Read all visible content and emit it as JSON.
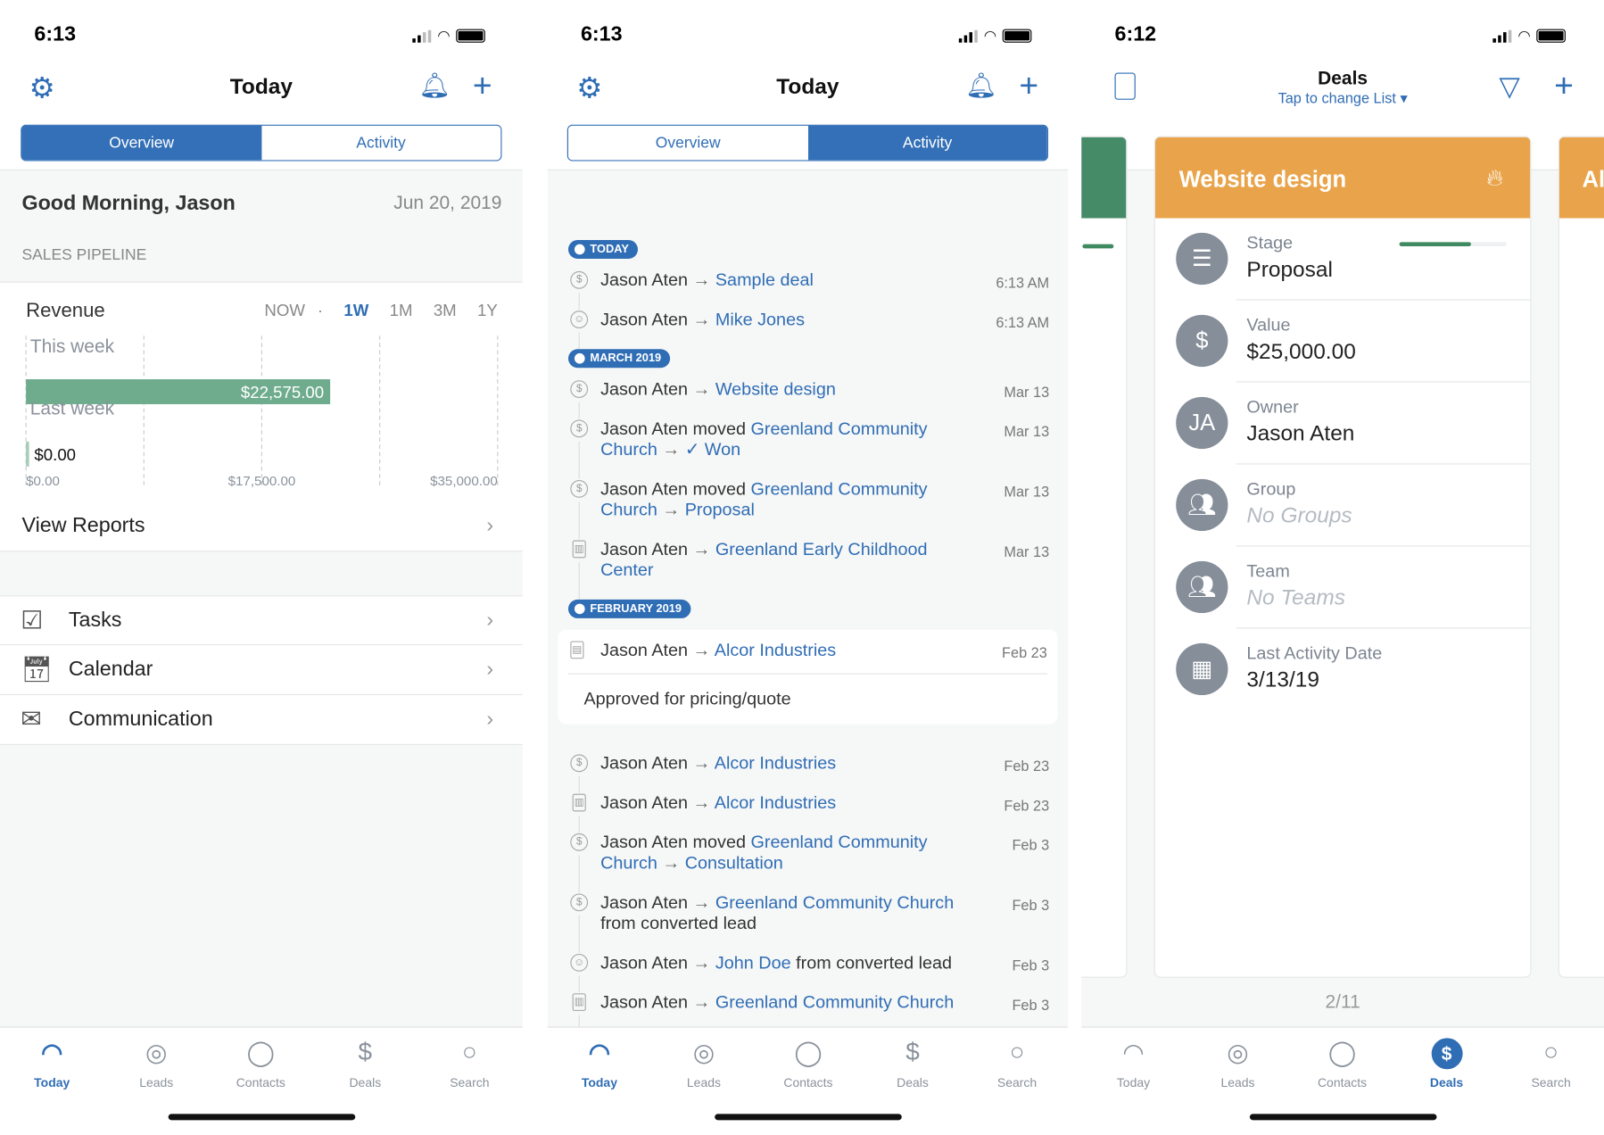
{
  "colors": {
    "accent": "#2f6db5",
    "revenue_bar": "#6fac8e",
    "deal_header": "#e9a44b",
    "prev_deal_header": "#468b68",
    "icon_circle": "#858e99"
  },
  "panels": [
    {
      "status_time": "6:13",
      "title": "Today",
      "segments": [
        "Overview",
        "Activity"
      ],
      "active_segment": 0
    },
    {
      "status_time": "6:13",
      "title": "Today",
      "segments": [
        "Overview",
        "Activity"
      ],
      "active_segment": 1
    },
    {
      "status_time": "6:12",
      "title": "Deals",
      "subtitle": "Tap to change List"
    }
  ],
  "overview": {
    "greeting": "Good Morning, Jason",
    "date": "Jun 20, 2019",
    "section": "SALES PIPELINE",
    "revenue_label": "Revenue",
    "ranges": [
      "NOW",
      "·",
      "1W",
      "1M",
      "3M",
      "1Y"
    ],
    "active_range": "1W",
    "view_reports": "View Reports",
    "menu": [
      {
        "label": "Tasks",
        "icon": "checkbox-icon"
      },
      {
        "label": "Calendar",
        "icon": "calendar-icon"
      },
      {
        "label": "Communication",
        "icon": "communication-icon"
      }
    ]
  },
  "chart_data": {
    "type": "bar",
    "orientation": "horizontal",
    "categories": [
      "This week",
      "Last week"
    ],
    "values": [
      22575,
      0
    ],
    "data_labels": [
      "$22,575.00",
      "$0.00"
    ],
    "xlim": [
      0,
      35000
    ],
    "xticks": [
      "$0.00",
      "$17,500.00",
      "$35,000.00"
    ],
    "grid": true
  },
  "activity": [
    {
      "pill": "TODAY"
    },
    {
      "icon": "deal",
      "parts": [
        [
          "t",
          "Jason Aten "
        ],
        [
          "a",
          "→ "
        ],
        [
          "l",
          "Sample deal"
        ]
      ],
      "time": "6:13 AM"
    },
    {
      "icon": "contact",
      "parts": [
        [
          "t",
          "Jason Aten "
        ],
        [
          "a",
          "→ "
        ],
        [
          "l",
          "Mike Jones"
        ]
      ],
      "time": "6:13 AM"
    },
    {
      "pill": "MARCH 2019"
    },
    {
      "icon": "deal",
      "parts": [
        [
          "t",
          "Jason Aten "
        ],
        [
          "a",
          "→ "
        ],
        [
          "l",
          "Website design"
        ]
      ],
      "time": "Mar 13"
    },
    {
      "icon": "deal",
      "parts": [
        [
          "t",
          "Jason Aten moved "
        ],
        [
          "l",
          "Greenland Community Church"
        ],
        [
          "a",
          " → "
        ],
        [
          "c",
          "✓ Won"
        ]
      ],
      "time": "Mar 13"
    },
    {
      "icon": "deal",
      "parts": [
        [
          "t",
          "Jason Aten moved "
        ],
        [
          "l",
          "Greenland Community Church"
        ],
        [
          "a",
          " → "
        ],
        [
          "l",
          "Proposal"
        ]
      ],
      "time": "Mar 13"
    },
    {
      "icon": "org",
      "parts": [
        [
          "t",
          "Jason Aten "
        ],
        [
          "a",
          "→ "
        ],
        [
          "l",
          "Greenland Early Childhood Center"
        ]
      ],
      "time": "Mar 13"
    },
    {
      "pill": "FEBRUARY 2019"
    },
    {
      "icon": "note",
      "parts": [
        [
          "t",
          "Jason Aten "
        ],
        [
          "a",
          "→ "
        ],
        [
          "l",
          "Alcor Industries"
        ]
      ],
      "time": "Feb 23",
      "note": "Approved for pricing/quote"
    },
    {
      "icon": "deal",
      "parts": [
        [
          "t",
          "Jason Aten "
        ],
        [
          "a",
          "→ "
        ],
        [
          "l",
          "Alcor Industries"
        ]
      ],
      "time": "Feb 23"
    },
    {
      "icon": "org",
      "parts": [
        [
          "t",
          "Jason Aten "
        ],
        [
          "a",
          "→ "
        ],
        [
          "l",
          "Alcor Industries"
        ]
      ],
      "time": "Feb 23"
    },
    {
      "icon": "deal",
      "parts": [
        [
          "t",
          "Jason Aten moved "
        ],
        [
          "l",
          "Greenland Community Church"
        ],
        [
          "a",
          " → "
        ],
        [
          "l",
          "Consultation"
        ]
      ],
      "time": "Feb 3"
    },
    {
      "icon": "deal",
      "parts": [
        [
          "t",
          "Jason Aten "
        ],
        [
          "a",
          "→ "
        ],
        [
          "l",
          "Greenland Community Church"
        ],
        [
          "t",
          " from converted lead"
        ]
      ],
      "time": "Feb 3"
    },
    {
      "icon": "contact",
      "parts": [
        [
          "t",
          "Jason Aten "
        ],
        [
          "a",
          "→ "
        ],
        [
          "l",
          "John Doe"
        ],
        [
          "t",
          " from converted lead"
        ]
      ],
      "time": "Feb 3"
    },
    {
      "icon": "org",
      "parts": [
        [
          "t",
          "Jason Aten "
        ],
        [
          "a",
          "→ "
        ],
        [
          "l",
          "Greenland Community Church"
        ]
      ],
      "time": "Feb 3"
    }
  ],
  "deal": {
    "title": "Website design",
    "stage_progress": 0.67,
    "pager": "2/11",
    "next_card_title": "Al",
    "fields": [
      {
        "label": "Stage",
        "value": "Proposal",
        "icon": "funnel-stage-icon"
      },
      {
        "label": "Value",
        "value": "$25,000.00",
        "icon": "dollar-icon"
      },
      {
        "label": "Owner",
        "value": "Jason Aten",
        "icon": "avatar",
        "initials": "JA"
      },
      {
        "label": "Group",
        "value": "No Groups",
        "placeholder": true,
        "icon": "group-icon"
      },
      {
        "label": "Team",
        "value": "No Teams",
        "placeholder": true,
        "icon": "team-icon"
      },
      {
        "label": "Last Activity Date",
        "value": "3/13/19",
        "icon": "calendar-icon"
      }
    ]
  },
  "tabs": [
    {
      "label": "Today",
      "icon": "gauge-icon"
    },
    {
      "label": "Leads",
      "icon": "leads-icon"
    },
    {
      "label": "Contacts",
      "icon": "contacts-icon"
    },
    {
      "label": "Deals",
      "icon": "deals-icon"
    },
    {
      "label": "Search",
      "icon": "search-icon"
    }
  ],
  "active_tabs": [
    "Today",
    "Today",
    "Deals"
  ]
}
